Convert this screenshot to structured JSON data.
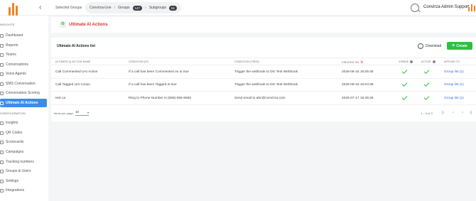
{
  "header": {
    "selected_groups_label": "Selected Groups",
    "breadcrumb": {
      "account": "Convirza-Live",
      "groups_label": "Groups",
      "groups_count": "147",
      "subgroups_label": "Subgroups",
      "subgroups_count": "61"
    },
    "user_name": "Convirza Admin Support",
    "brand_color": "#f58220"
  },
  "sidebar": {
    "sections": [
      {
        "title": "INSIGHTS"
      },
      {
        "title": "CONFIGURATION"
      }
    ],
    "items": [
      {
        "label": "Dashboard"
      },
      {
        "label": "Reports"
      },
      {
        "label": "Teams"
      },
      {
        "label": "Conversations"
      },
      {
        "label": "Voice Agents"
      },
      {
        "label": "SMS Conversation"
      },
      {
        "label": "Conversation Scoring"
      },
      {
        "label": "Ultimate AI Actions",
        "active": true
      },
      {
        "label": "Insights"
      },
      {
        "label": "QR Codes"
      },
      {
        "label": "Scorecards"
      },
      {
        "label": "Campaigns"
      },
      {
        "label": "Tracking numbers"
      },
      {
        "label": "Groups & Users"
      },
      {
        "label": "Settings"
      },
      {
        "label": "Integrations"
      }
    ],
    "active_color": "#3b8de8"
  },
  "page": {
    "title": "Ultimate AI Actions",
    "title_color": "#d9342b"
  },
  "list": {
    "title": "Ultimate AI Actions list",
    "download_label": "Download",
    "create_label": "Create",
    "create_color": "#2fbf3f",
    "columns": {
      "name": "ULTIMATE AI ACTION NAME",
      "condition_if": "CONDITION (IF)",
      "condition_then": "CONDITION (THEN)",
      "created_on": "CREATED ON",
      "visible": "VISIBLE",
      "active": "ACTIVE",
      "applied_to": "APPLIED TO"
    },
    "rows": [
      {
        "name": "Call Commented UAI Action",
        "if": "If a call has been Commented on is true",
        "then": "Trigger the webhook to DG Test Webhook",
        "created": "2026-06-16 16:05:45",
        "applied": "Group list (1)"
      },
      {
        "name": "Call Tagged UAI Action",
        "if": "If a call has been Tagged is true",
        "then": "Trigger the webhook to DG Test Webhook",
        "created": "2026-06-16 16:04:39",
        "applied": "Group list (1)"
      },
      {
        "name": "test ca",
        "if": "Ring to Phone Number is (555)-555-5555",
        "then": "Send email to abc@convirza.com",
        "created": "2026-07-17 15:45:25",
        "applied": "Group list (1)"
      }
    ],
    "pagination": {
      "items_per_page_label": "Items per page:",
      "items_per_page": "10",
      "range": "1 – 3 of 3"
    }
  }
}
